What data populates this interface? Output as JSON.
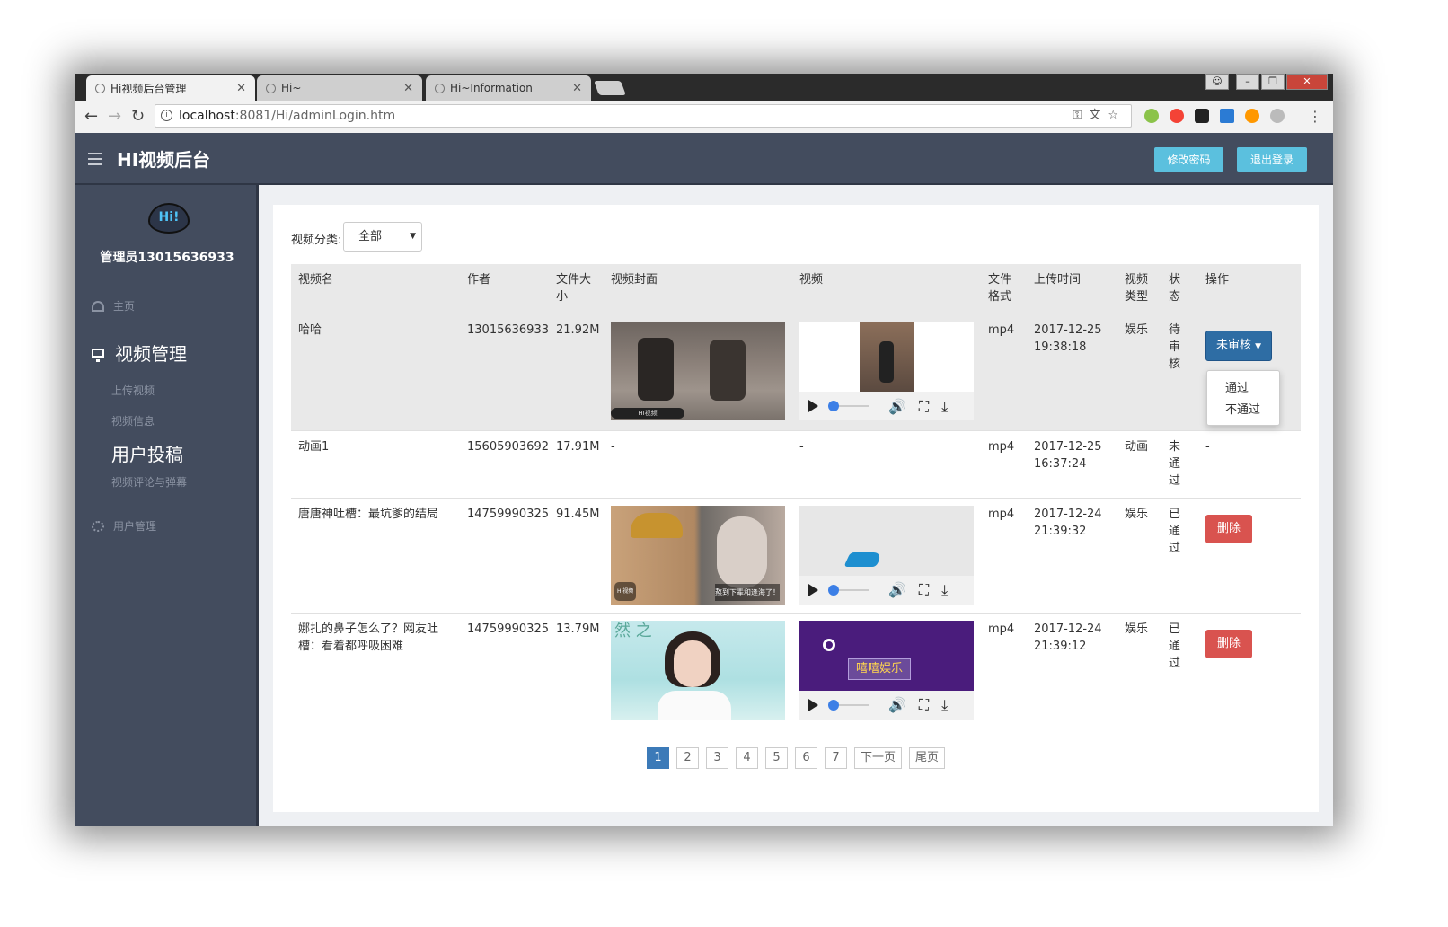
{
  "browser": {
    "tabs": [
      {
        "title": "Hi视频后台管理"
      },
      {
        "title": "Hi~"
      },
      {
        "title": "Hi~Information"
      }
    ],
    "url_host": "localhost",
    "url_path": ":8081/Hi/adminLogin.htm"
  },
  "header": {
    "brand": "HI视频后台",
    "change_password": "修改密码",
    "logout": "退出登录"
  },
  "sidebar": {
    "avatar_text": "Hi!",
    "admin_name": "管理员13015636933",
    "home": "主页",
    "video_mgmt": "视频管理",
    "sub_items": [
      "上传视频",
      "视频信息",
      "用户投稿",
      "视频评论与弹幕"
    ],
    "user_mgmt": "用户管理"
  },
  "filter": {
    "label": "视频分类:",
    "selected": "全部"
  },
  "table": {
    "headers": [
      "视频名",
      "作者",
      "文件大小",
      "视频封面",
      "视频",
      "文件格式",
      "上传时间",
      "视频类型",
      "状态",
      "操作"
    ],
    "rows": [
      {
        "name": "哈哈",
        "author": "13015636933",
        "size": "21.92M",
        "cover": "",
        "video": "",
        "format": "mp4",
        "time": "2017-12-25 19:38:18",
        "type": "娱乐",
        "status": "待审核",
        "action": "未审核"
      },
      {
        "name": "动画1",
        "author": "15605903692",
        "size": "17.91M",
        "cover": "-",
        "video": "-",
        "format": "mp4",
        "time": "2017-12-25 16:37:24",
        "type": "动画",
        "status": "未通过",
        "action": "-"
      },
      {
        "name": "唐唐神吐槽：最坑爹的结局",
        "author": "14759990325",
        "size": "91.45M",
        "cover": "",
        "video": "",
        "format": "mp4",
        "time": "2017-12-24 21:39:32",
        "type": "娱乐",
        "status": "已通过",
        "action": "删除"
      },
      {
        "name": "娜扎的鼻子怎么了？网友吐槽：看着都呼吸困难",
        "author": "14759990325",
        "size": "13.79M",
        "cover": "",
        "video": "",
        "format": "mp4",
        "time": "2017-12-24 21:39:12",
        "type": "娱乐",
        "status": "已通过",
        "action": "删除"
      }
    ]
  },
  "media_text": {
    "cover1_caption": "HI视频",
    "cover3_caption": "HI视频",
    "cover3_subtitle": "熬到下辈和逢海了！",
    "cover4_chars": "然 之",
    "video4_label": "嘻嘻娱乐"
  },
  "dropdown": {
    "items": [
      "通过",
      "不通过"
    ]
  },
  "pagination": {
    "pages": [
      "1",
      "2",
      "3",
      "4",
      "5",
      "6",
      "7"
    ],
    "next": "下一页",
    "last": "尾页",
    "current": "1"
  },
  "icons": {
    "back": "arrow-left-icon",
    "forward": "arrow-right-icon",
    "reload": "reload-icon",
    "key": "key-icon",
    "translate": "translate-icon",
    "star": "star-icon",
    "menu": "hamburger-icon",
    "home": "dashboard-icon",
    "monitor": "monitor-icon",
    "users": "gears-icon"
  },
  "colors": {
    "header_bg": "#434c5e",
    "accent_info": "#5bc0de",
    "primary": "#2e6da4",
    "danger": "#d9534f",
    "pager_active": "#3c7ab8"
  }
}
